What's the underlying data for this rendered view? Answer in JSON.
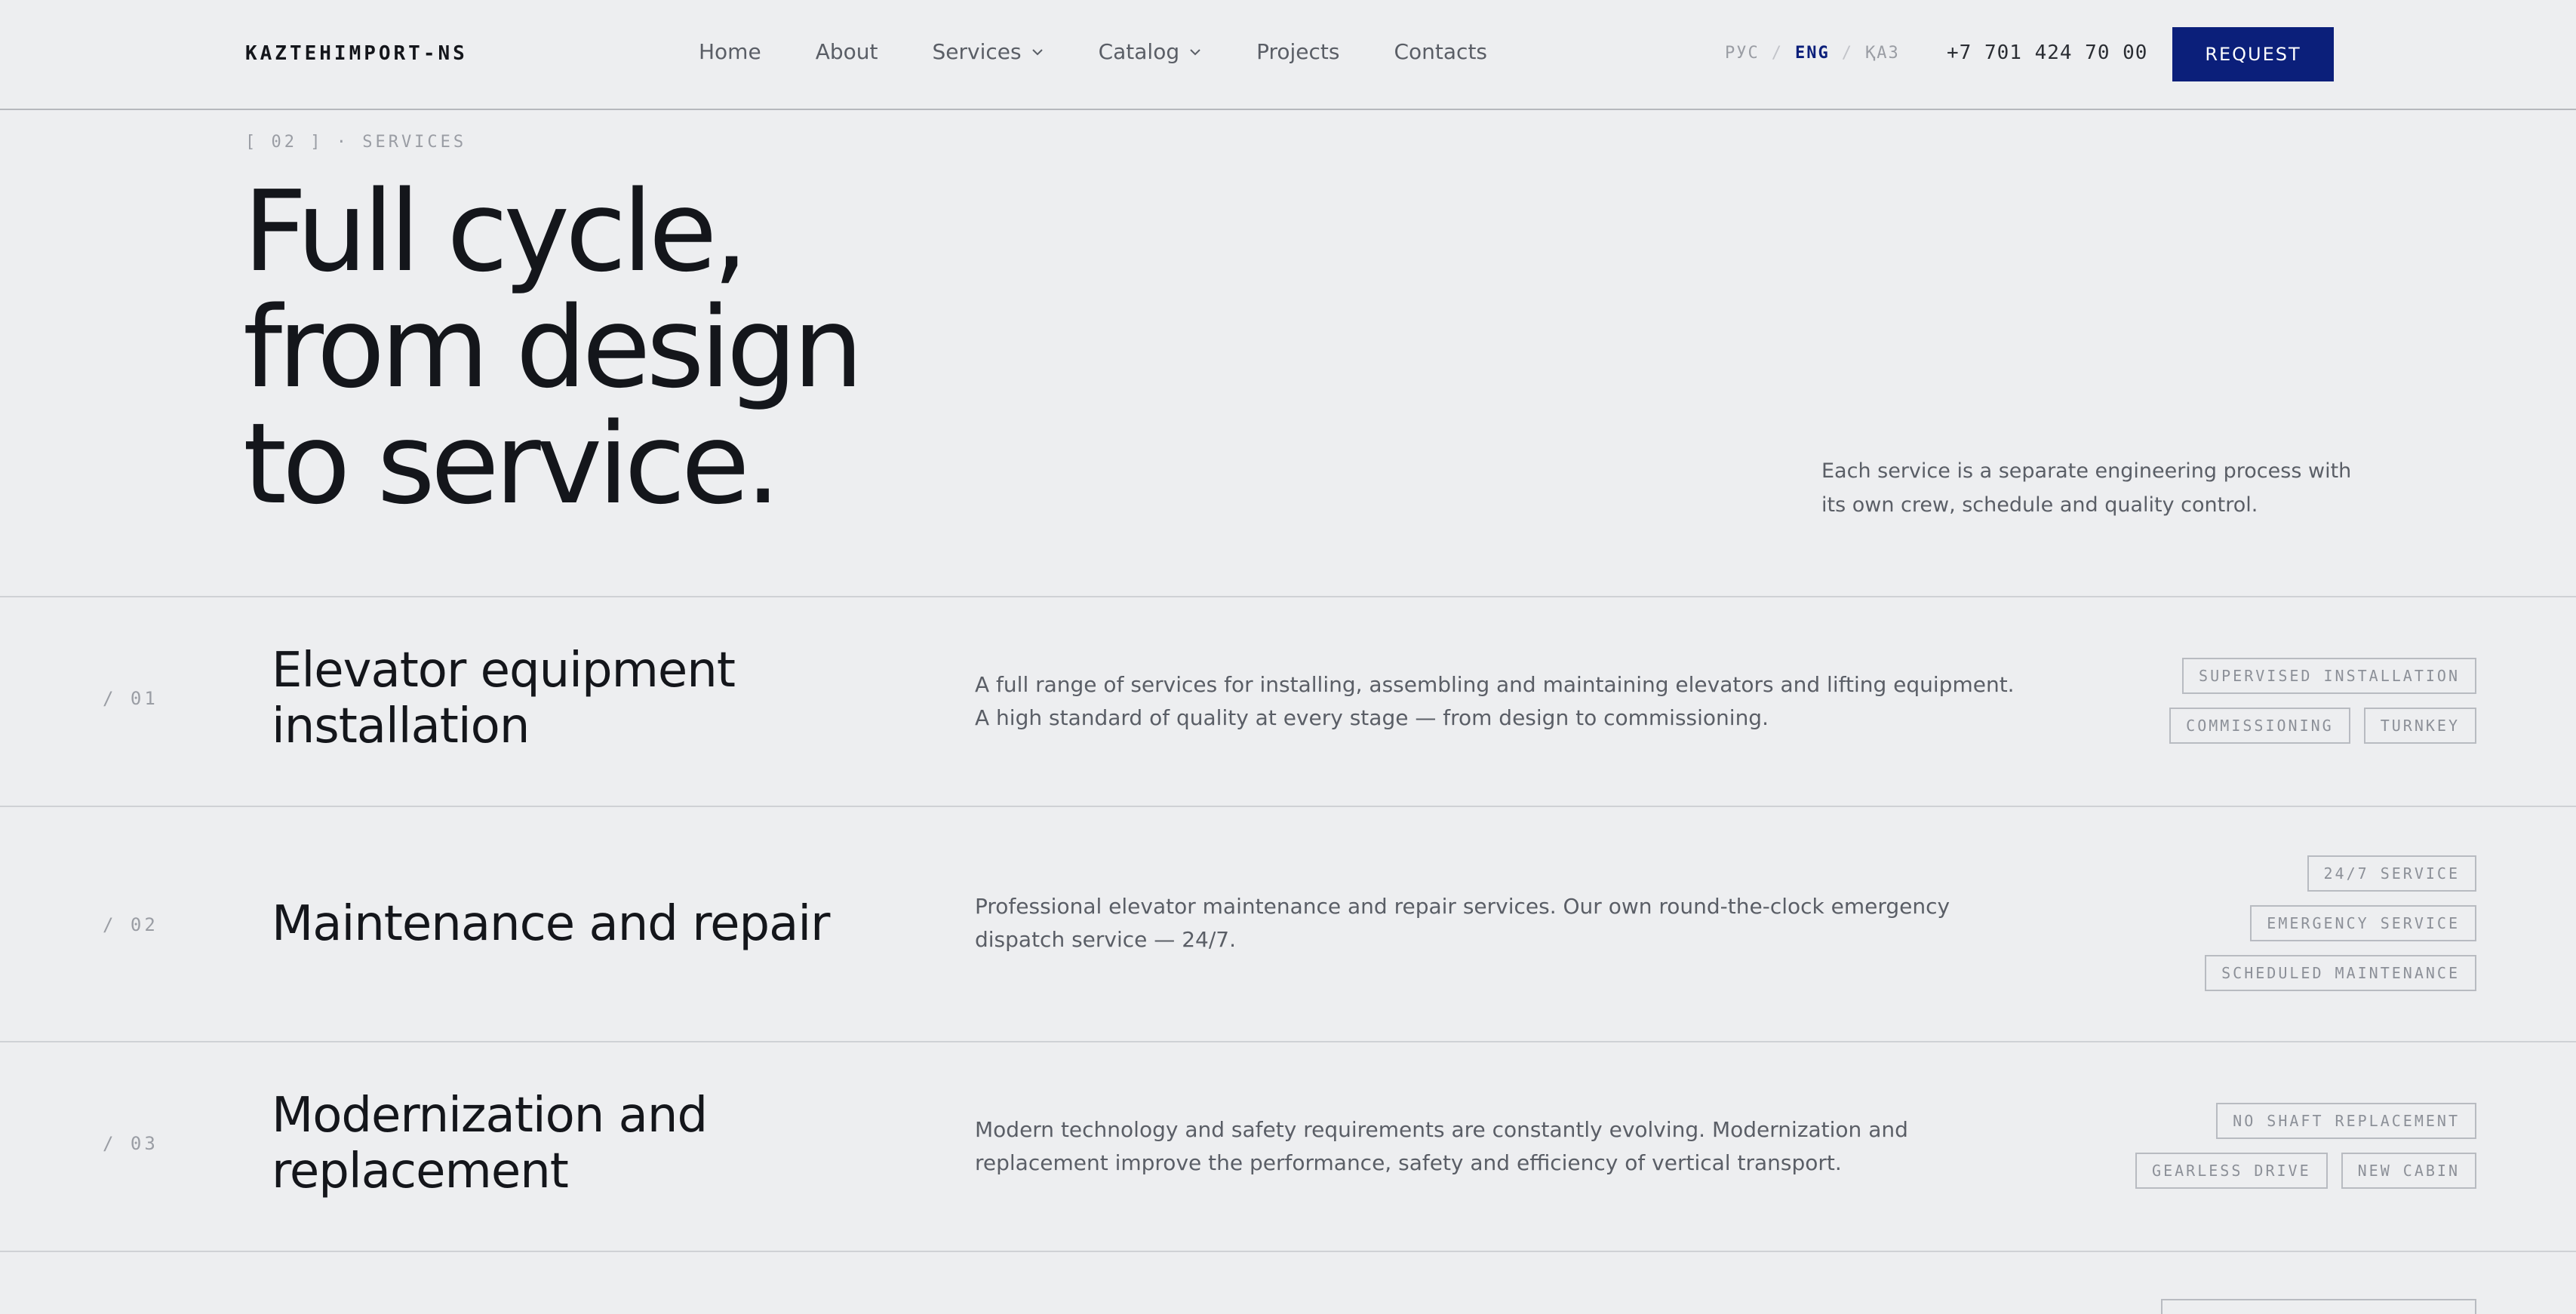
{
  "header": {
    "logo": "KAZTEHIMPORT-NS",
    "nav": [
      {
        "label": "Home"
      },
      {
        "label": "About"
      },
      {
        "label": "Services",
        "dropdown": true
      },
      {
        "label": "Catalog",
        "dropdown": true
      },
      {
        "label": "Projects"
      },
      {
        "label": "Contacts"
      }
    ],
    "languages": [
      {
        "code": "РУС",
        "active": false
      },
      {
        "code": "ENG",
        "active": true
      },
      {
        "code": "ҚАЗ",
        "active": false
      }
    ],
    "language_separator": "/",
    "phone": "+7 701 424 70 00",
    "request_label": "REQUEST"
  },
  "hero": {
    "eyebrow": "[ 02 ] · SERVICES",
    "headline_lines": [
      "Full cycle,",
      "from design",
      "to service."
    ],
    "note": "Each service is a separate engineering process with its own crew, schedule and quality control."
  },
  "services": [
    {
      "num": "/ 01",
      "title": "Elevator equipment installation",
      "description": "A full range of services for installing, assembling and maintaining elevators and lifting equipment. A high standard of quality at every stage — from design to commissioning.",
      "tag_rows": [
        [
          "SUPERVISED INSTALLATION"
        ],
        [
          "COMMISSIONING",
          "TURNKEY"
        ]
      ]
    },
    {
      "num": "/ 02",
      "title": "Maintenance and repair",
      "description": "Professional elevator maintenance and repair services. Our own round-the-clock emergency dispatch service — 24/7.",
      "tag_rows": [
        [
          "24/7 SERVICE"
        ],
        [
          "EMERGENCY SERVICE"
        ],
        [
          "SCHEDULED MAINTENANCE"
        ]
      ]
    },
    {
      "num": "/ 03",
      "title": "Modernization and replacement",
      "description": "Modern technology and safety requirements are constantly evolving. Modernization and replacement improve the performance, safety and efficiency of vertical transport.",
      "tag_rows": [
        [
          "NO SHAFT REPLACEMENT"
        ],
        [
          "GEARLESS DRIVE",
          "NEW CABIN"
        ]
      ]
    }
  ],
  "colors": {
    "background": "#edeef0",
    "accent": "#0b1f7a",
    "text": "#14161b",
    "muted": "#5a5e66",
    "divider": "#cfd1d5"
  }
}
